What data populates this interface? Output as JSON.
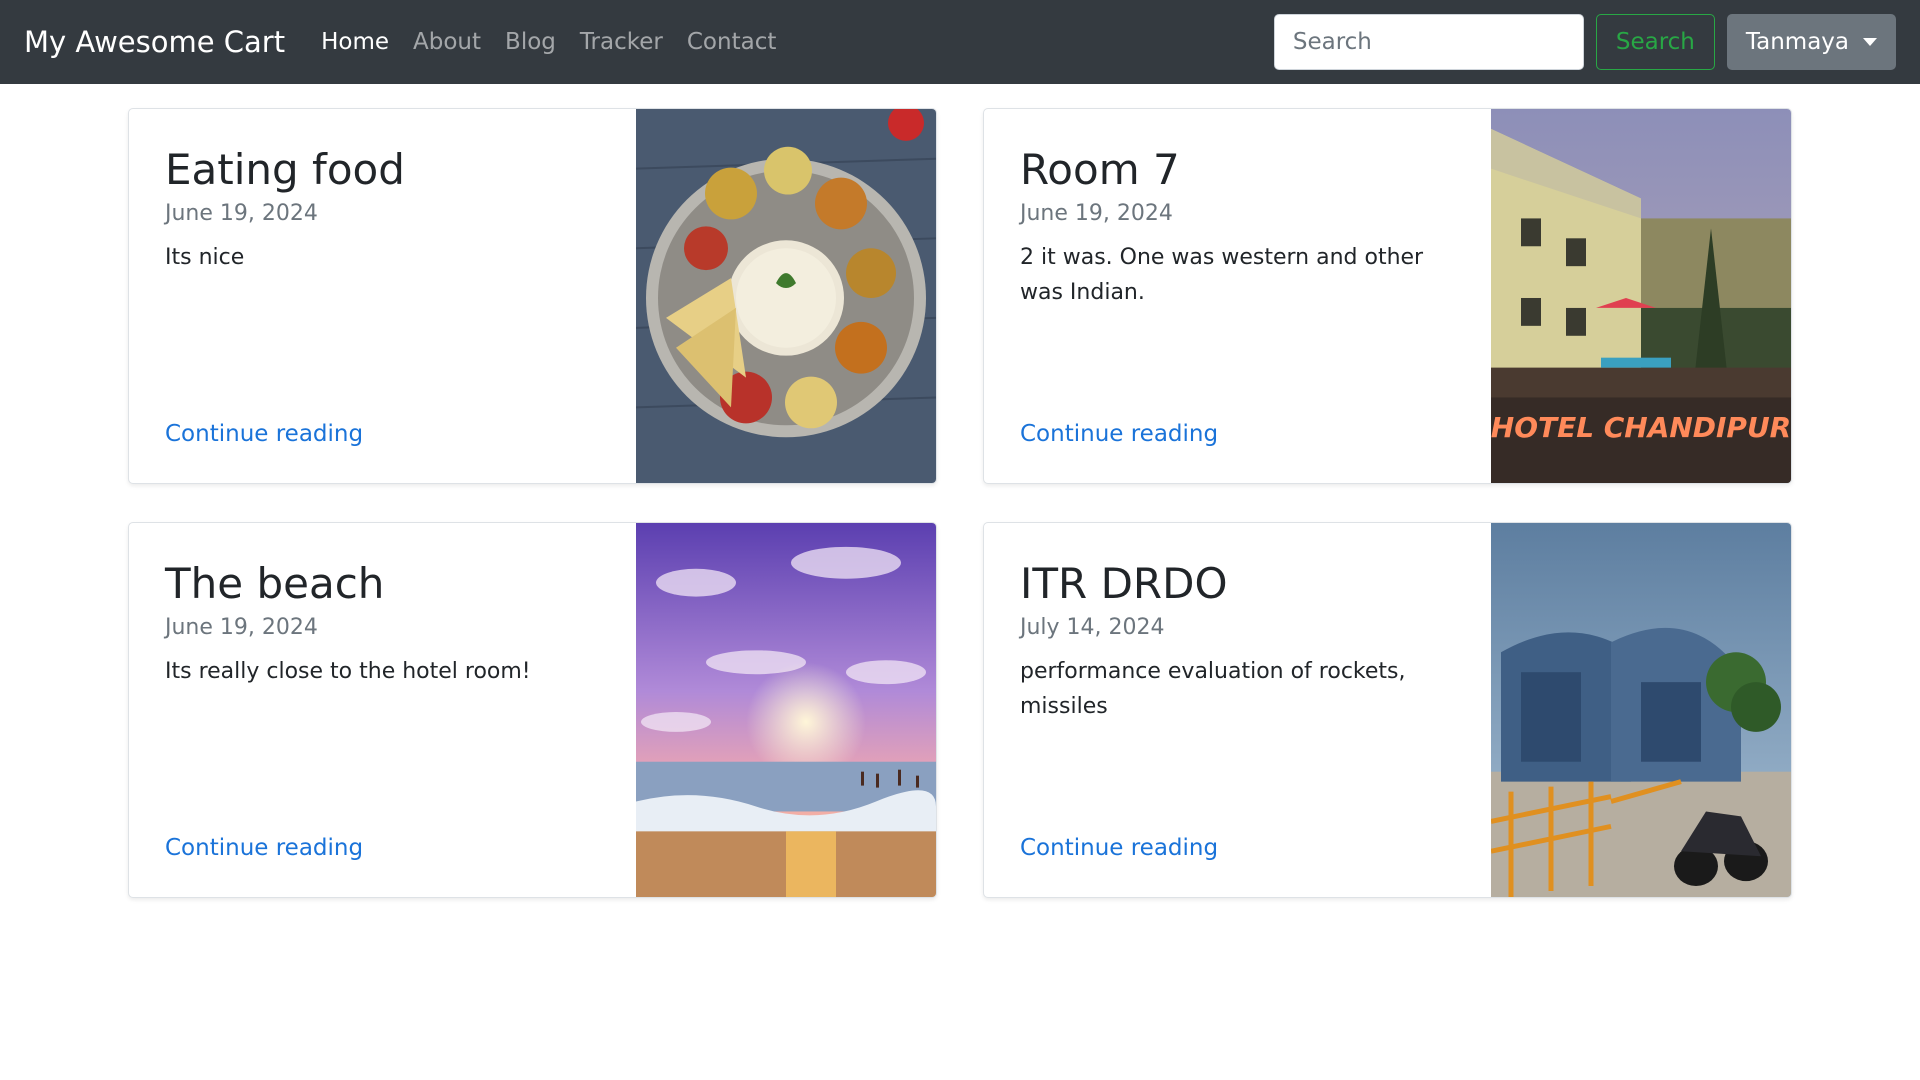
{
  "navbar": {
    "brand": "My Awesome Cart",
    "links": [
      {
        "label": "Home",
        "active": true
      },
      {
        "label": "About",
        "active": false
      },
      {
        "label": "Blog",
        "active": false
      },
      {
        "label": "Tracker",
        "active": false
      },
      {
        "label": "Contact",
        "active": false
      }
    ],
    "search": {
      "placeholder": "Search",
      "button_label": "Search"
    },
    "user": {
      "name": "Tanmaya"
    }
  },
  "posts": [
    {
      "title": "Eating food",
      "date": "June 19, 2024",
      "text": "Its nice",
      "link_label": "Continue reading",
      "image_icon": "food-thali-image"
    },
    {
      "title": "Room 7",
      "date": "June 19, 2024",
      "text": "2 it was. One was western and other was Indian.",
      "link_label": "Continue reading",
      "image_icon": "hotel-image",
      "image_caption": "HOTEL CHANDIPUR"
    },
    {
      "title": "The beach",
      "date": "June 19, 2024",
      "text": "Its really close to the hotel room!",
      "link_label": "Continue reading",
      "image_icon": "beach-sunset-image"
    },
    {
      "title": "ITR DRDO",
      "date": "July 14, 2024",
      "text": "performance evaluation of rockets, missiles",
      "link_label": "Continue reading",
      "image_icon": "itr-gate-image"
    }
  ],
  "colors": {
    "navbar_bg": "#343a40",
    "link": "#1a73d9",
    "success": "#28a745",
    "secondary": "#6c757d"
  }
}
